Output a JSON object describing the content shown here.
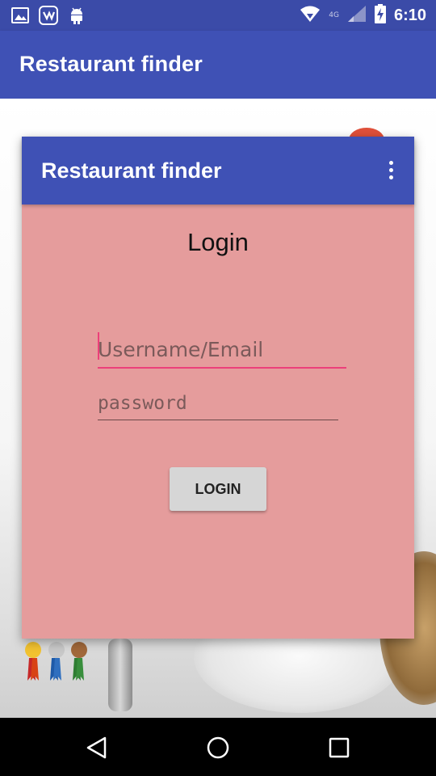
{
  "status_bar": {
    "time": "6:10",
    "network_label": "4G",
    "left_icons": [
      "image-icon",
      "saavn-icon",
      "android-icon"
    ],
    "right_icons": [
      "wifi-icon",
      "signal-icon",
      "battery-charging-icon"
    ]
  },
  "app_bar": {
    "title": "Restaurant finder"
  },
  "dialog": {
    "title": "Restaurant finder",
    "overflow_icon": "more-vert-icon",
    "heading": "Login",
    "username_placeholder": "Username/Email",
    "password_placeholder": "password",
    "login_label": "LOGIN"
  },
  "nav_bar": {
    "icons": [
      "back-icon",
      "home-icon",
      "recents-icon"
    ]
  },
  "colors": {
    "primary": "#3f51b5",
    "status_bar": "#3b4ba8",
    "dialog_bg": "#e59c9c",
    "accent": "#ec407a",
    "button_bg": "#d6d6d6"
  }
}
